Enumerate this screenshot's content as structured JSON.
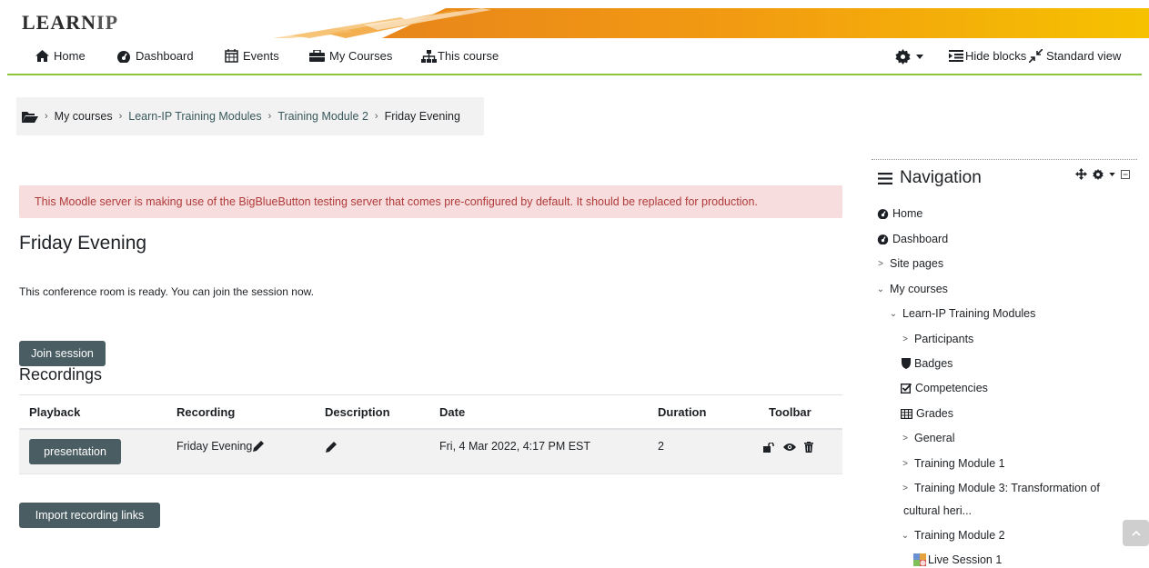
{
  "brand": {
    "logo_main": "LEARN",
    "logo_suffix": "IP"
  },
  "topnav": {
    "home": "Home",
    "dashboard": "Dashboard",
    "events": "Events",
    "my_courses": "My Courses",
    "this_course": "This course",
    "hide_blocks": "Hide blocks",
    "standard_view": "Standard view"
  },
  "breadcrumb": {
    "my_courses": "My courses",
    "category": "Learn-IP Training Modules",
    "module": "Training Module 2",
    "current": "Friday Evening"
  },
  "alert": {
    "text": "This Moodle server is making use of the BigBlueButton testing server that comes pre-configured by default. It should be replaced for production."
  },
  "main": {
    "title": "Friday Evening",
    "ready_text": "This conference room is ready. You can join the session now.",
    "join_label": "Join session",
    "recordings_heading": "Recordings",
    "import_label": "Import recording links"
  },
  "table": {
    "headers": {
      "playback": "Playback",
      "recording": "Recording",
      "description": "Description",
      "date": "Date",
      "duration": "Duration",
      "toolbar": "Toolbar"
    },
    "rows": [
      {
        "playback_label": "presentation",
        "recording": "Friday Evening",
        "date": "Fri, 4 Mar 2022, 4:17 PM EST",
        "duration": "2"
      }
    ]
  },
  "navigation": {
    "title": "Navigation",
    "items": [
      {
        "label": "Home"
      },
      {
        "label": "Dashboard"
      },
      {
        "label": "Site pages"
      },
      {
        "label": "My courses"
      },
      {
        "label": "Learn-IP Training Modules"
      },
      {
        "label": "Participants"
      },
      {
        "label": "Badges"
      },
      {
        "label": "Competencies"
      },
      {
        "label": "Grades"
      },
      {
        "label": "General"
      },
      {
        "label": "Training Module 1"
      },
      {
        "label": "Training Module 3: Transformation of"
      },
      {
        "label": "cultural heri..."
      },
      {
        "label": "Training Module 2"
      },
      {
        "label": "Live Session 1"
      }
    ]
  },
  "colors": {
    "accent_green": "#8cc63f",
    "button": "#4a5d63",
    "alert_bg": "#f7dddd",
    "alert_text": "#b03a3a",
    "link": "#39595d"
  }
}
